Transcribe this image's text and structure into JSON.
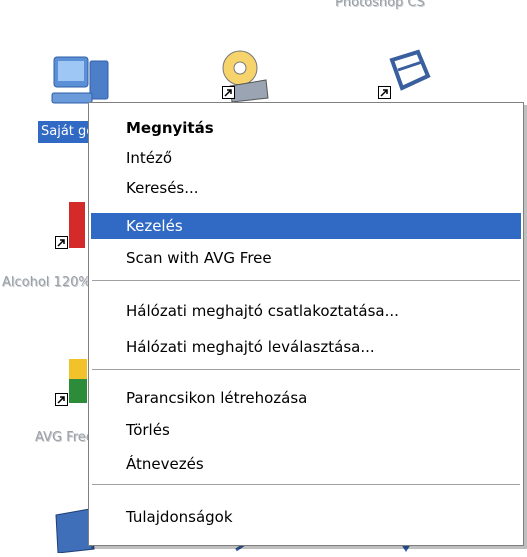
{
  "desktop": {
    "top_label": "Photoshop CS",
    "icons": [
      {
        "name": "my-computer",
        "label": "Saját gép",
        "selected": true
      },
      {
        "name": "alcohol",
        "label": "Alcohol 120%"
      },
      {
        "name": "avg",
        "label": "AVG Free"
      }
    ]
  },
  "context_menu": {
    "items": [
      {
        "label": "Megnyitás",
        "bold": true
      },
      {
        "label": "Intéző"
      },
      {
        "label": "Keresés..."
      },
      {
        "label": "Kezelés",
        "highlighted": true
      },
      {
        "label": "Scan with AVG Free"
      },
      {
        "separator": true
      },
      {
        "label": "Hálózati meghajtó csatlakoztatása..."
      },
      {
        "label": "Hálózati meghajtó leválasztása..."
      },
      {
        "separator": true
      },
      {
        "label": "Parancsikon létrehozása"
      },
      {
        "label": "Törlés"
      },
      {
        "label": "Átnevezés"
      },
      {
        "separator": true
      },
      {
        "label": "Tulajdonságok"
      }
    ]
  },
  "colors": {
    "selection": "#316ac5",
    "menu_border": "#808080"
  }
}
